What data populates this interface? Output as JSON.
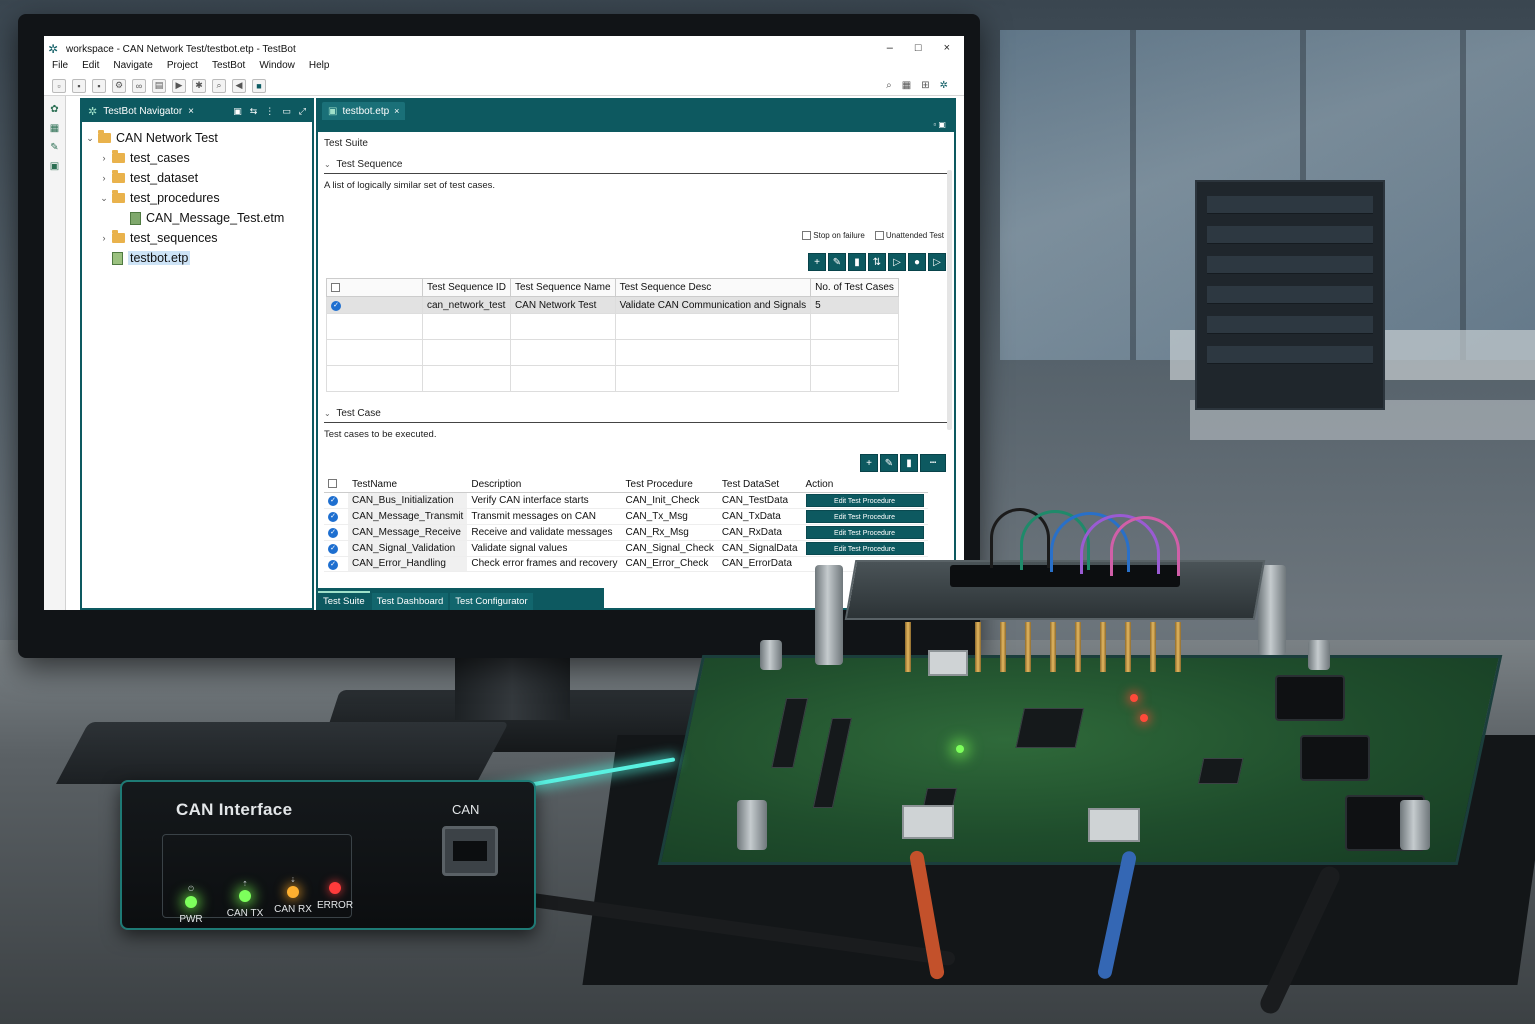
{
  "window": {
    "title": "workspace - CAN Network Test/testbot.etp - TestBot",
    "controls": {
      "minimize": "–",
      "maximize": "□",
      "close": "×"
    }
  },
  "menu": [
    "File",
    "Edit",
    "Navigate",
    "Project",
    "TestBot",
    "Window",
    "Help"
  ],
  "navigator": {
    "tab_label": "TestBot Navigator",
    "tree": [
      {
        "label": "CAN Network Test",
        "type": "project",
        "expanded": true,
        "depth": 0
      },
      {
        "label": "test_cases",
        "type": "folder",
        "expanded": false,
        "depth": 1
      },
      {
        "label": "test_dataset",
        "type": "folder",
        "expanded": false,
        "depth": 1
      },
      {
        "label": "test_procedures",
        "type": "folder",
        "expanded": true,
        "depth": 1
      },
      {
        "label": "CAN_Message_Test.etm",
        "type": "file",
        "depth": 2
      },
      {
        "label": "test_sequences",
        "type": "folder",
        "expanded": false,
        "depth": 1
      },
      {
        "label": "testbot.etp",
        "type": "file",
        "depth": 1,
        "selected": true
      }
    ]
  },
  "editor": {
    "tab_label": "testbot.etp",
    "suite_title": "Test Suite",
    "sequence_section": {
      "title": "Test Sequence",
      "description": "A list of logically similar set of test cases.",
      "options": {
        "stop_on_failure": "Stop on failure",
        "unattended_test": "Unattended Test"
      },
      "columns": [
        "Test Sequence ID",
        "Test Sequence Name",
        "Test Sequence Desc",
        "No. of Test Cases"
      ],
      "rows": [
        {
          "id": "can_network_test",
          "name": "CAN Network Test",
          "desc": "Validate CAN Communication and Signals",
          "count": "5"
        }
      ]
    },
    "case_section": {
      "title": "Test Case",
      "description": "Test cases to be executed.",
      "columns": [
        "TestName",
        "Description",
        "Test Procedure",
        "Test DataSet",
        "Action"
      ],
      "action_label": "Edit Test Procedure",
      "rows": [
        {
          "name": "CAN_Bus_Initialization",
          "desc": "Verify CAN interface starts",
          "procedure": "CAN_Init_Check",
          "dataset": "CAN_TestData"
        },
        {
          "name": "CAN_Message_Transmit",
          "desc": "Transmit messages on CAN",
          "procedure": "CAN_Tx_Msg",
          "dataset": "CAN_TxData"
        },
        {
          "name": "CAN_Message_Receive",
          "desc": "Receive and validate messages",
          "procedure": "CAN_Rx_Msg",
          "dataset": "CAN_RxData"
        },
        {
          "name": "CAN_Signal_Validation",
          "desc": "Validate signal values",
          "procedure": "CAN_Signal_Check",
          "dataset": "CAN_SignalData"
        },
        {
          "name": "CAN_Error_Handling",
          "desc": "Check error frames and recovery",
          "procedure": "CAN_Error_Check",
          "dataset": "CAN_ErrorData"
        }
      ]
    },
    "bottom_tabs": [
      "Test Suite",
      "Test Dashboard",
      "Test Configurator"
    ]
  },
  "hardware": {
    "can_interface_title": "CAN Interface",
    "port_label": "CAN",
    "leds": [
      {
        "label": "PWR",
        "color": "#7dff5c"
      },
      {
        "label": "CAN TX",
        "color": "#7dff5c"
      },
      {
        "label": "CAN RX",
        "color": "#ffb030"
      },
      {
        "label": "ERROR",
        "color": "#ff3b3b"
      }
    ]
  },
  "colors": {
    "accent": "#0d5960",
    "selection": "#cde3f6",
    "check": "#1e6fd0"
  }
}
